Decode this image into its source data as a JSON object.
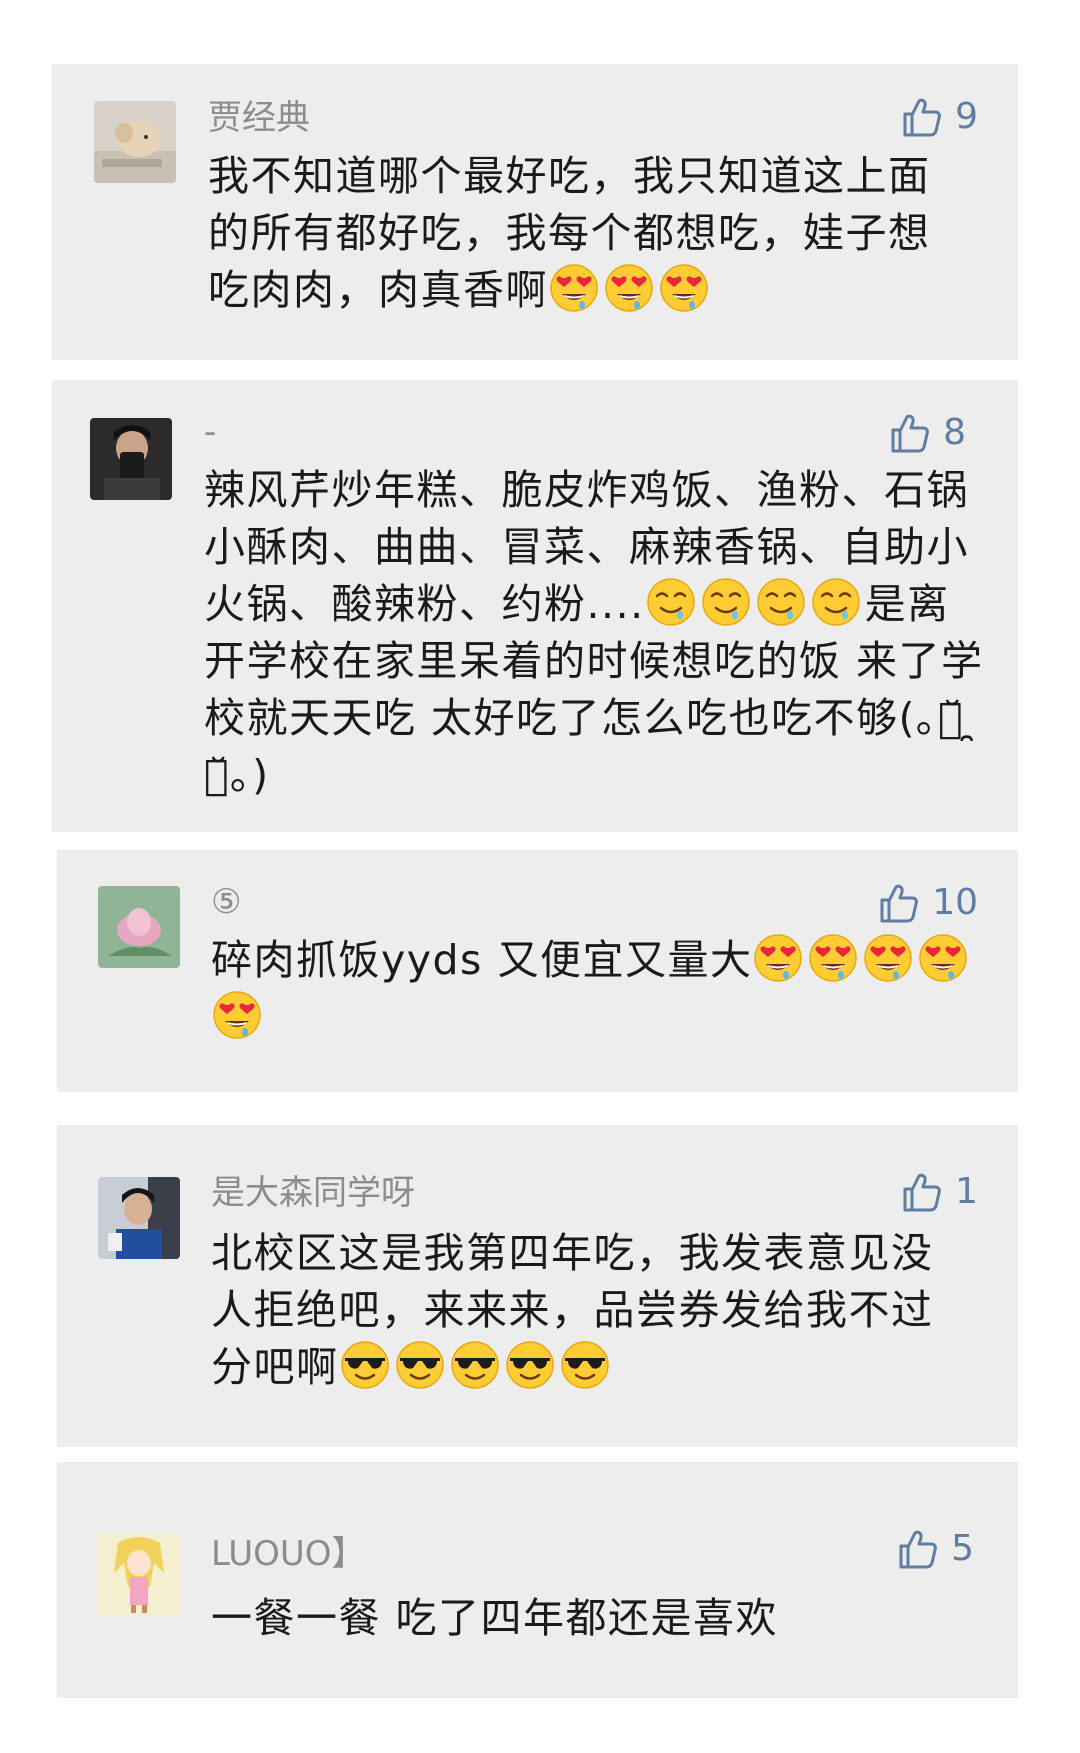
{
  "comments": [
    {
      "author": "贾经典",
      "likes": "9",
      "text": "我不知道哪个最好吃，我只知道这上面的所有都好吃，我每个都想吃，娃子想吃肉肉，肉真香啊",
      "emojis": [
        "heart-eyes-face",
        "heart-eyes-face",
        "heart-eyes-face"
      ],
      "text_after": ""
    },
    {
      "author": "-",
      "likes": "8",
      "text": "辣风芹炒年糕、脆皮炸鸡饭、渔粉、石锅小酥肉、曲曲、冒菜、麻辣香锅、自助小火锅、酸辣粉、约粉....",
      "emojis": [
        "drooling-face",
        "drooling-face",
        "drooling-face",
        "drooling-face"
      ],
      "text_after": "是离开学校在家里呆着的时候想吃的饭 来了学校就天天吃 太好吃了怎么吃也吃不够(｡･̆ ̯ ･̆｡)"
    },
    {
      "author": "⑤",
      "likes": "10",
      "text": "碎肉抓饭yyds 又便宜又量大",
      "emojis": [
        "heart-eyes-face",
        "heart-eyes-face",
        "heart-eyes-face",
        "heart-eyes-face",
        "heart-eyes-face"
      ],
      "text_after": ""
    },
    {
      "author": "是大森同学呀",
      "likes": "1",
      "text": "北校区这是我第四年吃，我发表意见没人拒绝吧，来来来，品尝券发给我不过分吧啊",
      "emojis": [
        "sunglasses-face",
        "sunglasses-face",
        "sunglasses-face",
        "sunglasses-face",
        "sunglasses-face"
      ],
      "text_after": ""
    },
    {
      "author": "LUOUO】",
      "likes": "5",
      "text": "一餐一餐 吃了四年都还是喜欢",
      "emojis": [],
      "text_after": ""
    }
  ],
  "colors": {
    "card_bg": "#ededed",
    "author_text": "#8c8c8c",
    "like_accent": "#5f7da3",
    "body_text": "#1a1a1a"
  },
  "icons": {
    "like": "thumbs-up-icon"
  }
}
